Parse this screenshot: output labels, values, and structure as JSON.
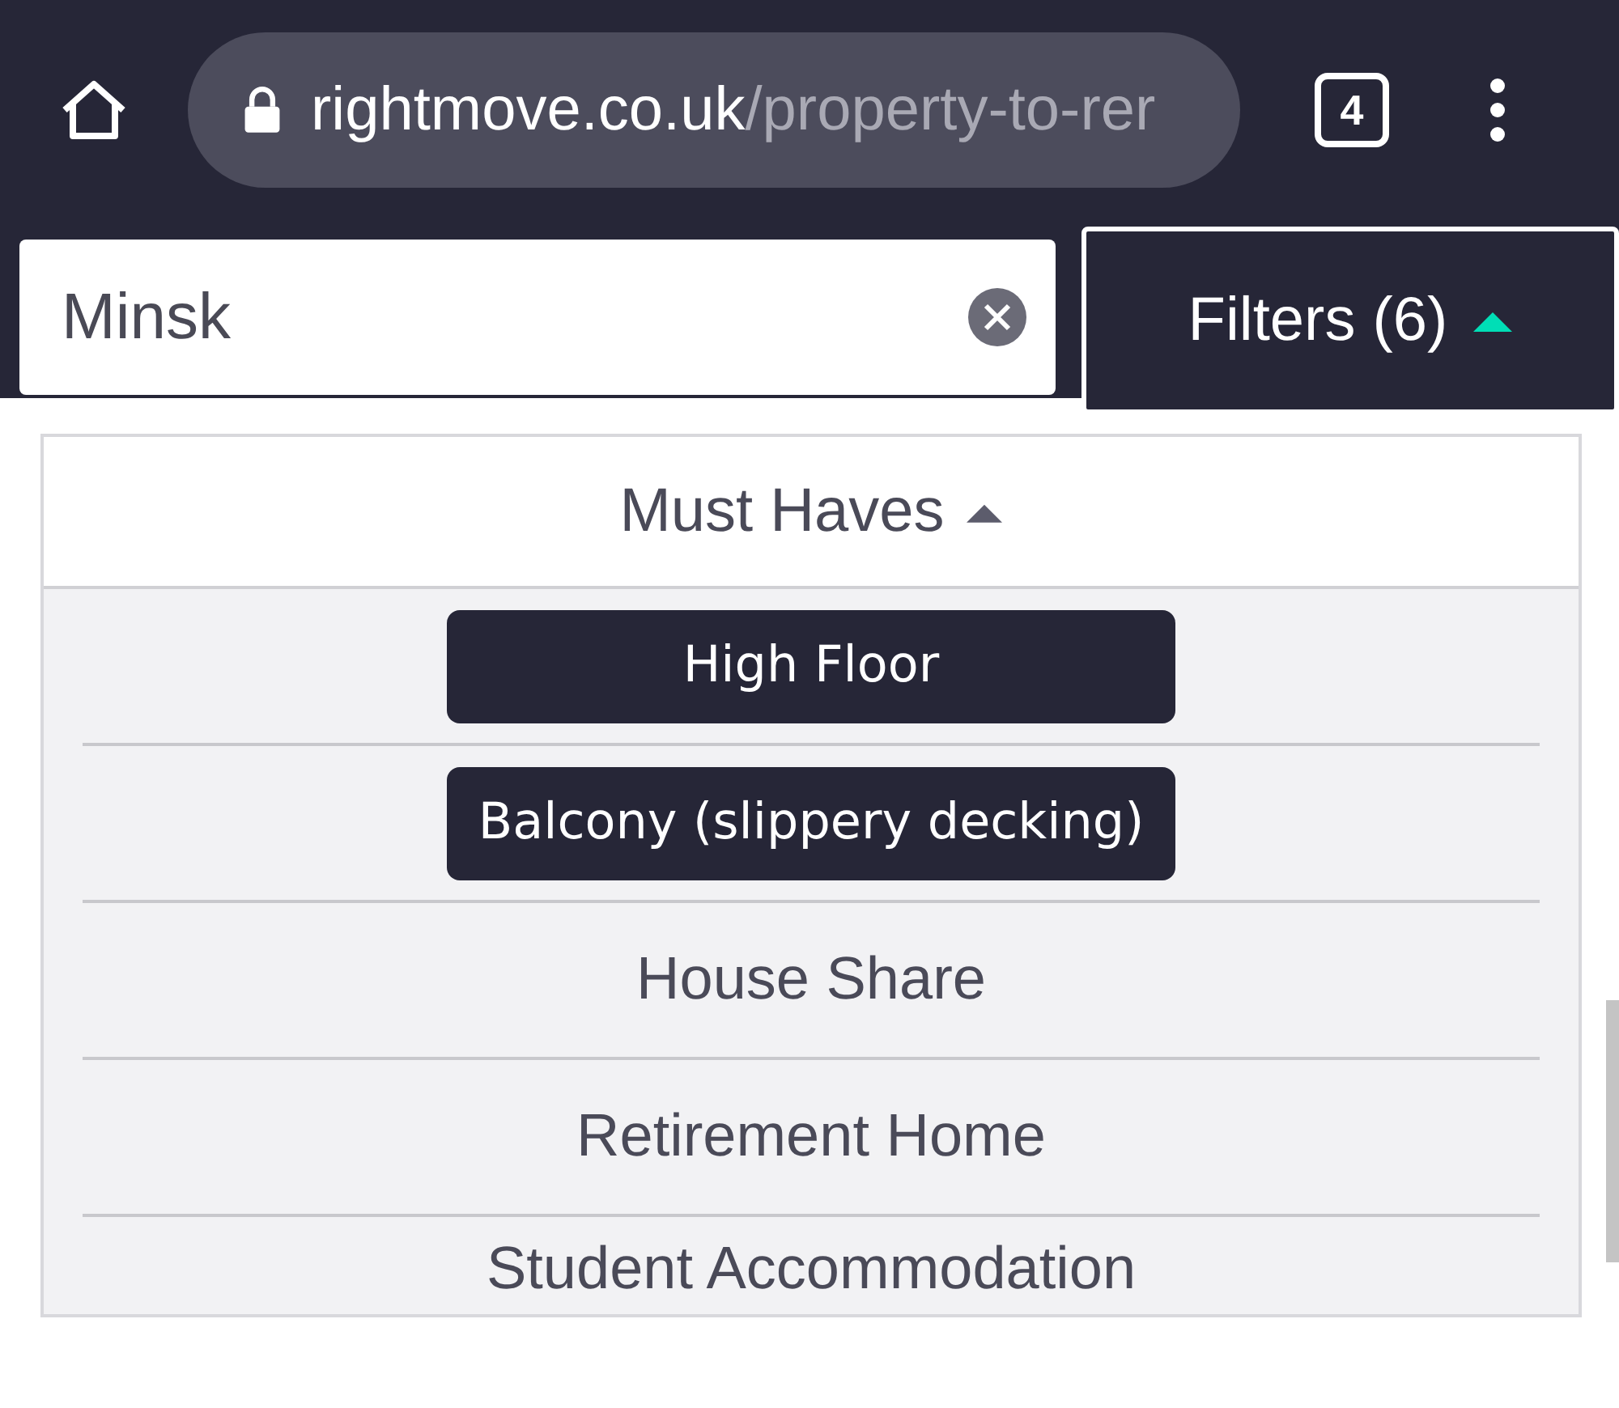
{
  "browser": {
    "url_host": "rightmove.co.uk",
    "url_path": "/property-to-rer",
    "tab_count": "4"
  },
  "search": {
    "value": "Minsk"
  },
  "filters_button": {
    "label": "Filters (6)",
    "expanded": true
  },
  "must_haves": {
    "title": "Must Haves",
    "expanded": true,
    "options": [
      {
        "label": "High Floor",
        "selected": true
      },
      {
        "label": "Balcony (slippery decking)",
        "selected": true
      },
      {
        "label": "House Share",
        "selected": false
      },
      {
        "label": "Retirement Home",
        "selected": false
      },
      {
        "label": "Student Accommodation",
        "selected": false
      }
    ]
  }
}
